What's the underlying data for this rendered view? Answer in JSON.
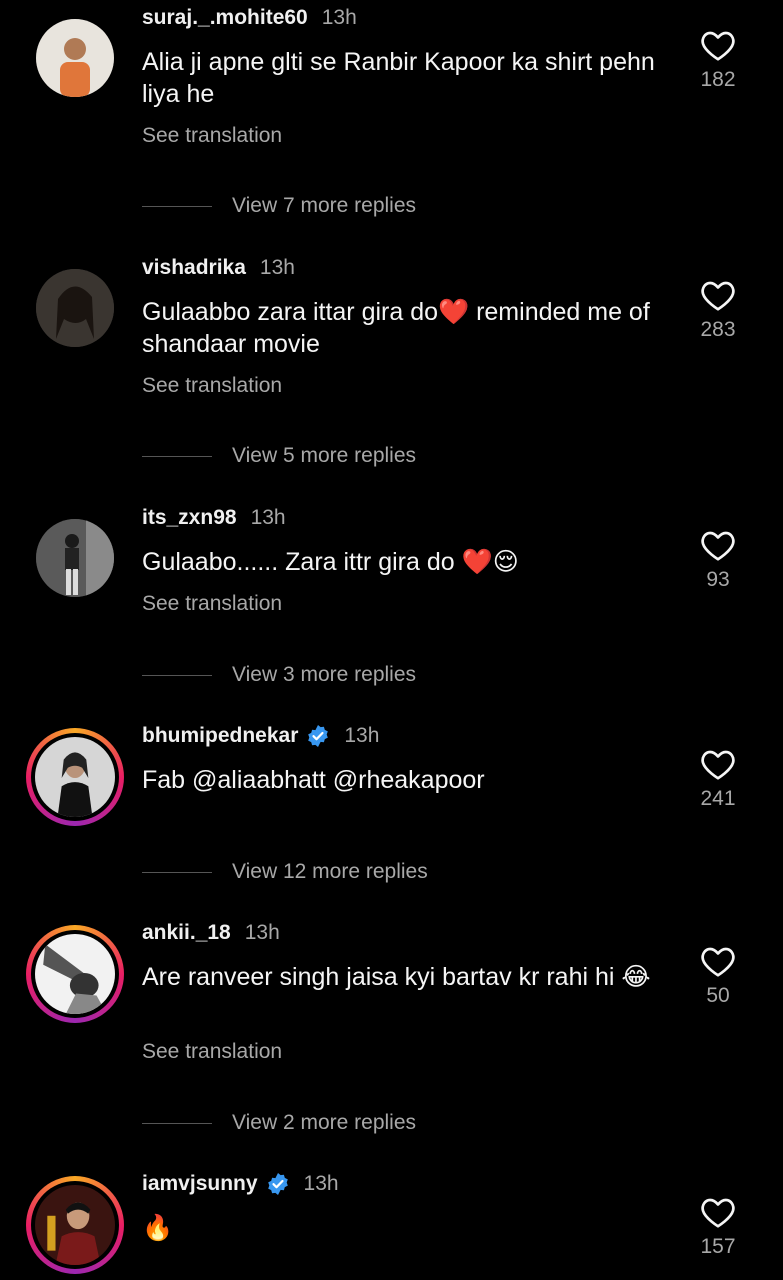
{
  "comments": [
    {
      "username": "suraj._.mohite60",
      "verified": false,
      "time": "13h",
      "text": "Alia ji apne glti se Ranbir Kapoor ka shirt pehn liya he",
      "see_translation": "See translation",
      "likes": "182",
      "replies": "View 7 more replies"
    },
    {
      "username": "vishadrika",
      "verified": false,
      "time": "13h",
      "text": "Gulaabbo zara ittar gira do❤️ reminded me of shandaar movie",
      "see_translation": "See translation",
      "likes": "283",
      "replies": "View 5 more replies"
    },
    {
      "username": "its_zxn98",
      "verified": false,
      "time": "13h",
      "text": "Gulaabo...... Zara ittr gira do ❤️😌",
      "see_translation": "See translation",
      "likes": "93",
      "replies": "View 3 more replies"
    },
    {
      "username": "bhumipednekar",
      "verified": true,
      "time": "13h",
      "text": "Fab @aliaabhatt @rheakapoor",
      "likes": "241",
      "replies": "View 12 more replies"
    },
    {
      "username": "ankii._18",
      "verified": false,
      "time": "13h",
      "text": "Are ranveer singh jaisa kyi bartav kr rahi hi 😂",
      "see_translation": "See translation",
      "likes": "50",
      "replies": "View 2 more replies"
    },
    {
      "username": "iamvjsunny",
      "verified": true,
      "time": "13h",
      "text": "🔥",
      "likes": "157"
    }
  ]
}
